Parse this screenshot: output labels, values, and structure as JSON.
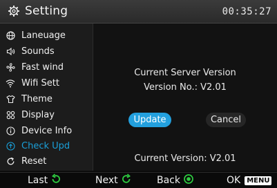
{
  "header": {
    "title": "Setting",
    "time": "00:35:27",
    "icon": "gear-icon"
  },
  "sidebar": {
    "items": [
      {
        "label": "Laneuage",
        "icon": "globe-icon"
      },
      {
        "label": "Sounds",
        "icon": "speaker-icon"
      },
      {
        "label": "Fast wind",
        "icon": "fan-icon"
      },
      {
        "label": "Wifi Sett",
        "icon": "wifi-icon"
      },
      {
        "label": "Theme",
        "icon": "shirt-icon"
      },
      {
        "label": "Display",
        "icon": "display-grid-icon"
      },
      {
        "label": "Device Info",
        "icon": "info-icon"
      },
      {
        "label": "Check Upd",
        "icon": "upload-icon",
        "selected": true
      },
      {
        "label": "Reset",
        "icon": "reset-icon"
      }
    ]
  },
  "main": {
    "server_heading": "Current Server Version",
    "server_version": "Version No.: V2.01",
    "update_label": "Update",
    "cancel_label": "Cancel",
    "current_version": "Current Version: V2.01"
  },
  "footer": {
    "last_label": "Last",
    "next_label": "Next",
    "back_label": "Back",
    "ok_label": "OK",
    "menu_badge": "MENU"
  },
  "colors": {
    "accent": "#23a0de",
    "footer_icon_green": "#2ecc40"
  }
}
